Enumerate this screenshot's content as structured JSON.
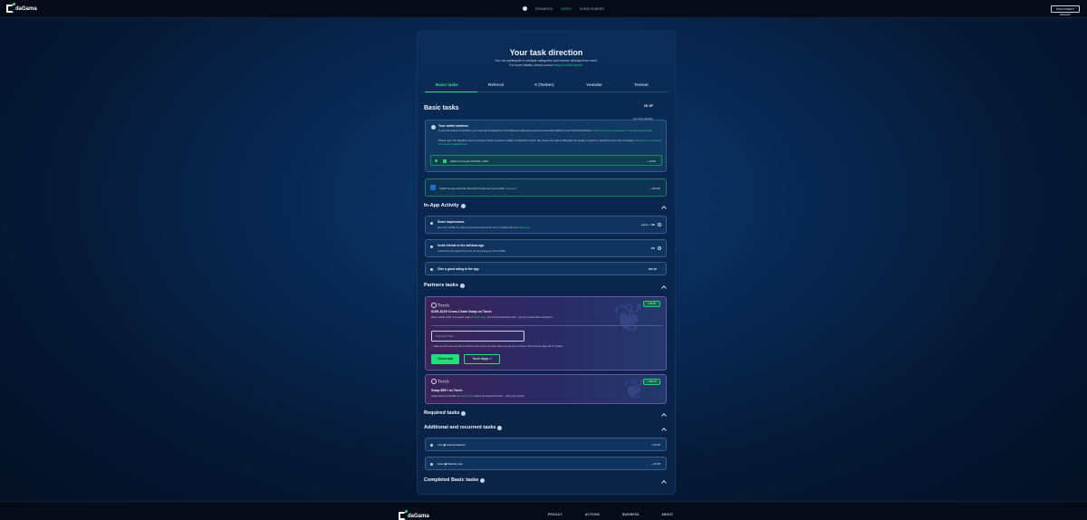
{
  "brand": {
    "name": "daGama"
  },
  "nav": {
    "items": [
      "REWARDS",
      "INDEX",
      "SUBSCRIBERS"
    ],
    "active_index": 1
  },
  "header": {
    "disconnect_label": "DISCONNECT WALLET"
  },
  "page": {
    "title": "Your task direction",
    "subtitle_line1": "You can participate in multiple categories and receive airdrops from each.",
    "subtitle_line2_prefix": "For more details, check out our ",
    "subtitle_link": "easy-to-follow guide.",
    "tabs": [
      {
        "label": "Basic tasks",
        "active": true
      },
      {
        "label": "Referral",
        "active": false
      },
      {
        "label": "X (Twitter)",
        "active": false
      },
      {
        "label": "Youtube",
        "active": false
      },
      {
        "label": "Testnet",
        "active": false
      }
    ]
  },
  "basic": {
    "heading": "Basic tasks",
    "xp_value": "2K XP",
    "xp_sub": "Your XP by direction",
    "wallet": {
      "title": "Your wallet address",
      "text1": "To join the Airdrop competition, you must sign transactions in the daGama mobile app using the same wallet added to your Airdrop Dashboard.",
      "text1_link": "Learn how to sign transactions in the daGama app here.",
      "text2": "Please note: Our algorithms and community closely review the quality of submitted content. We reserve the right to disqualify low-quality or spammy submissions from the competition.",
      "text2_link": "Make sure to review the community guidelines here.",
      "row_label": "Wallet Connected 0x5c90b...0663",
      "row_xp": "+ 10 XP"
    },
    "install": {
      "label": "Install the app and enter the referral code from your profile",
      "required": "Required",
      "xp": "+ 100 XP"
    }
  },
  "inapp": {
    "heading": "In-App Activity",
    "tasks": [
      {
        "title": "Share impressions",
        "desc": "Earn 100 CoinBits for sharing impressions with friends from 3 CoinBits still need.",
        "desc_link": "More guide",
        "xp": "up to + 100"
      },
      {
        "title": "Invite friends to the daGama app",
        "desc": "Invite friend who makes first post in the app brings you 100 CoinBits.",
        "desc_link": "",
        "xp": "100"
      },
      {
        "title": "Give a good rating to the app",
        "desc": "",
        "desc_link": "",
        "xp": "300 XP"
      }
    ]
  },
  "partners": {
    "heading": "Partners tasks",
    "cards": [
      {
        "brand": "Torch",
        "badge": "+ 80 XP",
        "title": "$10K-$100 Cross-Chain Swap on Torch",
        "desc": "Make a $10K-100K cross-chain swap on ",
        "desc_link": "Torch dApp",
        "desc_tail": ", submit the transaction hash -- get your reward after verification.",
        "input_placeholder": "Transaction Hash",
        "warning": "Make sure that your swap with a result from own and any one-chain. Swap may take up to 2 minutes. Don't close the page until it's complete.",
        "check_label": "Check task",
        "dapp_label": "Torch dApp ↗"
      },
      {
        "brand": "Torch",
        "badge": "+ 150 XP",
        "title": "Swap $50+ on Torch",
        "desc": "Swap tokens worth $50+ on ",
        "desc_link": "Torch dApp",
        "desc_tail": ", submit the transaction hash -- claim your reward."
      }
    ]
  },
  "required": {
    "heading": "Required tasks"
  },
  "additional": {
    "heading": "Additional and recurrent tasks",
    "tasks": [
      {
        "prefix": "Your",
        "label": "channel address",
        "xp": "+ 30 XP"
      },
      {
        "prefix": "Enter",
        "label": "Referral code",
        "xp": "+ 15 XP"
      }
    ]
  },
  "completed": {
    "heading": "Completed Basic tasks"
  },
  "footer": {
    "links": [
      "PRIVACY",
      "ACTIONS",
      "BUSINESS",
      "ABOUT"
    ]
  }
}
